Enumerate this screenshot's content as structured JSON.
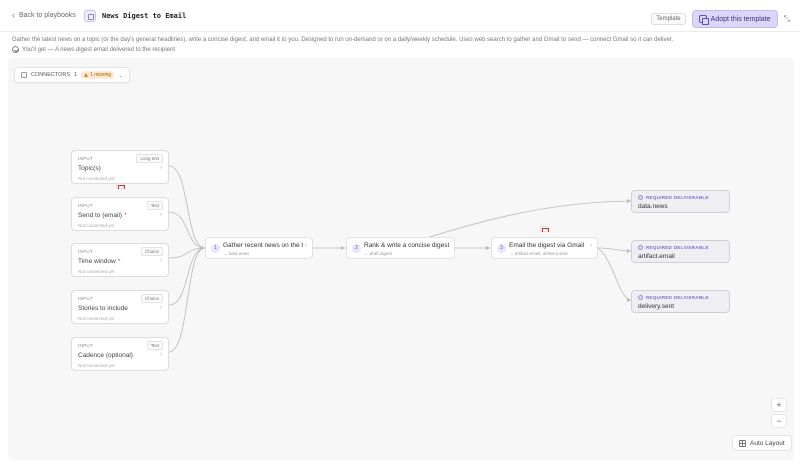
{
  "header": {
    "back_label": "Back to playbooks",
    "title": "News Digest to Email",
    "template_badge": "Template",
    "adopt_label": "Adopt this template"
  },
  "description": "Gather the latest news on a topic (or the day's general headlines), write a concise digest, and email it to you. Designed to run on-demand or on a daily/weekly schedule. Uses web search to gather and Gmail to send — connect Gmail so it can deliver.",
  "you_get": "You'll get — A news digest email delivered to the recipient",
  "connectors": {
    "label": "CONNECTORS",
    "count": "1",
    "missing": "1 missing"
  },
  "inputs": [
    {
      "tag": "INPUT",
      "type": "Long text",
      "label": "Topic(s)",
      "required": false,
      "status": "Not connected yet"
    },
    {
      "tag": "INPUT",
      "type": "Text",
      "label": "Send to (email)",
      "required": true,
      "status": "Not connected yet"
    },
    {
      "tag": "INPUT",
      "type": "Choice",
      "label": "Time window",
      "required": true,
      "status": "Not connected yet"
    },
    {
      "tag": "INPUT",
      "type": "Choice",
      "label": "Stories to include",
      "required": false,
      "status": "Not connected yet"
    },
    {
      "tag": "INPUT",
      "type": "Text",
      "label": "Cadence (optional)",
      "required": false,
      "status": "Not connected yet"
    }
  ],
  "steps": [
    {
      "num": "1",
      "title": "Gather recent news on the t...",
      "sub": "→ data.news"
    },
    {
      "num": "2",
      "title": "Rank & write a concise digest",
      "sub": "→ draft.digest"
    },
    {
      "num": "3",
      "title": "Email the digest via Gmail",
      "sub": "→ artifact.email, delivery.sent"
    }
  ],
  "deliverables": [
    {
      "tag": "REQUIRED DELIVERABLE",
      "label": "data.news"
    },
    {
      "tag": "REQUIRED DELIVERABLE",
      "label": "artifact.email"
    },
    {
      "tag": "REQUIRED DELIVERABLE",
      "label": "delivery.sent"
    }
  ],
  "controls": {
    "zoom_in": "+",
    "zoom_out": "−",
    "auto_layout": "Auto Layout"
  },
  "icons": {
    "back": "chevron-left-icon",
    "title": "document-icon",
    "adopt": "copy-icon",
    "collapse": "collapse-icon",
    "you_get": "check-circle-icon",
    "connectors": "plug-icon",
    "warning": "warning-icon",
    "gmail": "gmail-icon",
    "auto_layout": "grid-icon"
  },
  "colors": {
    "accent": "#dcd6f8",
    "accent_text": "#3b2e86",
    "required": "#d9362b",
    "warning_bg": "#fde9d4",
    "deliverable_tag": "#7c6fcf"
  }
}
